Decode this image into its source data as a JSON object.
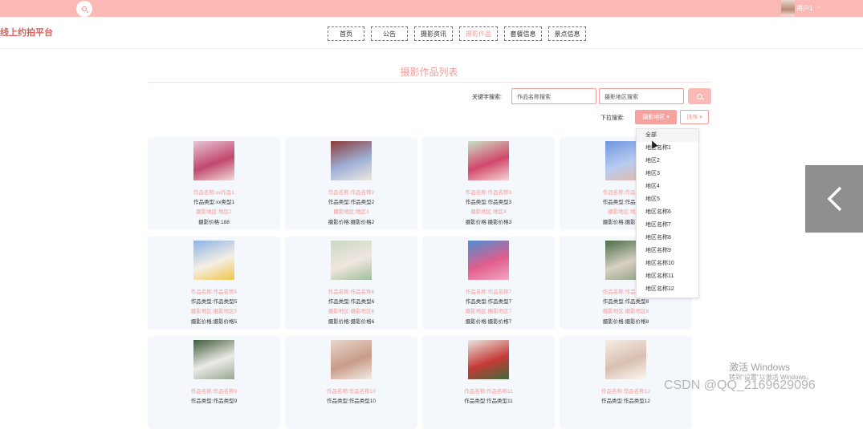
{
  "header": {
    "username": "用户1",
    "caret": "⌄"
  },
  "brand": {
    "logo": "线上约拍平台"
  },
  "nav": [
    {
      "label": "首页",
      "width": 46
    },
    {
      "label": "公告",
      "width": 46
    },
    {
      "label": "摄影资讯",
      "width": 48
    },
    {
      "label": "摄影作品",
      "width": 48,
      "active": true
    },
    {
      "label": "套餐信息",
      "width": 47
    },
    {
      "label": "景点信息",
      "width": 47
    }
  ],
  "page": {
    "title": "摄影作品列表"
  },
  "search": {
    "keyword_label": "关键字搜索:",
    "name_placeholder": "作品名称搜索",
    "area_placeholder": "摄影地区搜索",
    "dropdown_label": "下拉搜索:",
    "dropdown_value": "摄影地区",
    "sort_label": "排序"
  },
  "dropdown_options": [
    "全部",
    "地区名称1",
    "地区2",
    "地区3",
    "地区4",
    "地区5",
    "地区名称6",
    "地区名称7",
    "地区名称8",
    "地区名称9",
    "地区名称10",
    "地区名称11",
    "地区名称12"
  ],
  "cards": [
    {
      "name": "作品名称:xx作品1",
      "type": "作品类型:xx类型1",
      "area": "摄影地区:地区2",
      "price": "摄影价格:188",
      "colors": [
        "#e7c5d4",
        "#c2486e",
        "#f1ddd9"
      ]
    },
    {
      "name": "作品名称:作品名称2",
      "type": "作品类型:作品类型2",
      "area": "摄影地区:地区3",
      "price": "摄影价格:摄影价格2",
      "colors": [
        "#8c3b3b",
        "#9fb1d6",
        "#efe7e0"
      ]
    },
    {
      "name": "作品名称:作品名称3",
      "type": "作品类型:作品类型3",
      "area": "摄影地区:地区4",
      "price": "摄影价格:摄影价格3",
      "colors": [
        "#c9e0c5",
        "#d2476b",
        "#f6d6d6"
      ]
    },
    {
      "name": "作品名称:作品名称4",
      "type": "作品类型:作品类型4",
      "area": "摄影地区:地区5",
      "price": "摄影价格:摄影价格4",
      "colors": [
        "#6f95df",
        "#b9ccf1",
        "#e6b7a3"
      ]
    },
    {
      "name": "作品名称:作品名称5",
      "type": "作品类型:作品类型5",
      "area": "摄影地区:摄影地区5",
      "price": "摄影价格:摄影价格5",
      "colors": [
        "#8fb2e8",
        "#f4efe3",
        "#f0c34a"
      ]
    },
    {
      "name": "作品名称:作品名称6",
      "type": "作品类型:作品类型6",
      "area": "摄影地区:摄影地区6",
      "price": "摄影价格:摄影价格6",
      "colors": [
        "#c9d9c2",
        "#f0e6e0",
        "#9fbf9a"
      ]
    },
    {
      "name": "作品名称:作品名称7",
      "type": "作品类型:作品类型7",
      "area": "摄影地区:摄影地区7",
      "price": "摄影价格:摄影价格7",
      "colors": [
        "#4d8ed4",
        "#e05d8c",
        "#f3a6c0"
      ]
    },
    {
      "name": "作品名称:作品名称8",
      "type": "作品类型:作品类型8",
      "area": "摄影地区:摄影地区8",
      "price": "摄影价格:摄影价格8",
      "colors": [
        "#4b6d46",
        "#d8d0c4",
        "#8ea07e"
      ]
    },
    {
      "name": "作品名称:作品名称9",
      "type": "作品类型:作品类型9",
      "area": "",
      "price": "",
      "colors": [
        "#3f5b3a",
        "#eceae6",
        "#98a893"
      ]
    },
    {
      "name": "作品名称:作品名称10",
      "type": "作品类型:作品类型10",
      "area": "",
      "price": "",
      "colors": [
        "#e7d6cc",
        "#c89c88",
        "#f4ebe6"
      ]
    },
    {
      "name": "作品名称:作品名称11",
      "type": "作品类型:作品类型11",
      "area": "",
      "price": "",
      "colors": [
        "#e9e5df",
        "#c53a37",
        "#3d6b3c"
      ]
    },
    {
      "name": "作品名称:作品名称12",
      "type": "作品类型:作品类型12",
      "area": "",
      "price": "",
      "colors": [
        "#f3ece6",
        "#d9c0b0",
        "#fbf7f3"
      ]
    }
  ],
  "watermark": {
    "title": "激活 Windows",
    "subtitle": "转到\"设置\"以激活 Windows。",
    "csdn": "CSDN @QQ_2169629096"
  }
}
